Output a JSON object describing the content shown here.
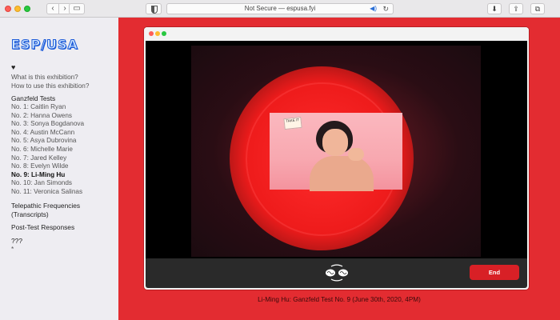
{
  "browser": {
    "nav_back": "‹",
    "nav_forward": "›",
    "sidebar_toggle": "▭",
    "url": "Not Secure — espusa.fyi",
    "speaker_glyph": "◀)",
    "reload_glyph": "↻",
    "download_glyph": "⬇",
    "share_glyph": "⇪",
    "tabs_glyph": "⧉"
  },
  "sidebar": {
    "logo": "ESP/USA",
    "heart": "♥",
    "about_links": [
      "What is this exhibition?",
      "How to use this exhibition?"
    ],
    "ganzfeld_title": "Ganzfeld Tests",
    "tests": [
      "No. 1: Caitlin Ryan",
      "No. 2: Hanna Owens",
      "No. 3: Sonya Bogdanova",
      "No. 4: Austin McCann",
      "No. 5: Asya Dubrovina",
      "No. 6: Michelle Marie",
      "No. 7: Jared Kelley",
      "No. 8: Evelyn Wilde",
      "No. 9: Li-Ming Hu",
      "No. 10: Jan Simonds",
      "No. 11: Veronica Salinas"
    ],
    "active_index": 8,
    "telepathic": [
      "Telepathic Frequencies",
      "(Transcripts)"
    ],
    "post_test": "Post-Test Responses",
    "questions": "???",
    "footnote": "*"
  },
  "video_call": {
    "note_text": "TAKE IT",
    "end_label": "End",
    "caption": "Li-Ming Hu: Ganzfeld Test No. 9 (June 30th, 2020, 4PM)"
  },
  "colors": {
    "accent_red": "#e32c31",
    "end_button": "#d82026",
    "logo_blue": "#1d5bd8"
  }
}
